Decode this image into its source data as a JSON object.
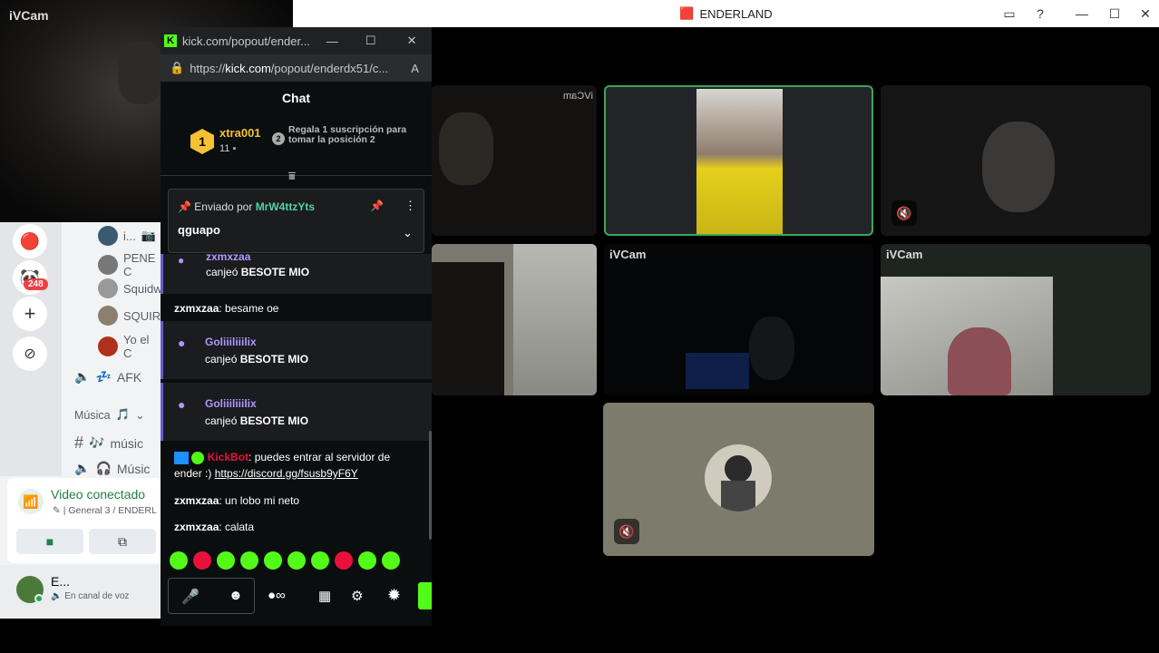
{
  "ivcam": {
    "title": "iVCam"
  },
  "discord": {
    "unread_badge": "248",
    "members": [
      {
        "name": "i...",
        "extra": "📷"
      },
      {
        "name": "PENE C"
      },
      {
        "name": "Squidw"
      },
      {
        "name": "SQUIRT"
      },
      {
        "name": "Yo el C"
      }
    ],
    "voice_channel": "AFK",
    "category": "Música",
    "text_channel": "músic",
    "voice_channel_2": "Músic",
    "voice_panel": {
      "title": "Video conectado",
      "subtitle": "| General 3 / ENDERL"
    },
    "user": {
      "name": "E...",
      "status": "En canal de voz"
    }
  },
  "call": {
    "title": "ENDERLAND",
    "tiles": [
      {
        "label": "iVCam"
      },
      {
        "label": "iVCam"
      },
      {
        "label": "iVCam"
      }
    ],
    "mirrored_label": "iVCam"
  },
  "kick": {
    "tab_title": "kick.com/popout/ender...",
    "url_prefix": "https://",
    "url_host": "kick.com",
    "url_path": "/popout/enderdx51/c...",
    "chat_title": "Chat",
    "leader": {
      "rank": "1",
      "name": "xtra001",
      "count": "11",
      "rank2": "2",
      "cta": "Regala 1 suscripción para tomar la posición 2"
    },
    "pinned": {
      "prefix": "Enviado por",
      "author": "MrW4ttzYts",
      "text": "qguapo"
    },
    "messages": [
      {
        "user": "zxmxzaa",
        "action": "canjeó",
        "item": "BESOTE MIO"
      },
      {
        "user": "zxmxzaa",
        "text": "besame oe"
      },
      {
        "user": "Goliiiliiilix",
        "action": "canjeó",
        "item": "BESOTE MIO"
      },
      {
        "user": "Goliiiliiilix",
        "action": "canjeó",
        "item": "BESOTE MIO"
      },
      {
        "user": "KickBot",
        "text": "puedes entrar al servidor de ender :) ",
        "link": "https://discord.gg/fsusb9yF6Y"
      },
      {
        "user": "zxmxzaa",
        "text": "un lobo mi neto"
      },
      {
        "user": "zxmxzaa",
        "text": "calata"
      }
    ],
    "colors": {
      "accent": "#53fc18",
      "purple": "#b197fc",
      "bot": "#e9113c"
    }
  }
}
